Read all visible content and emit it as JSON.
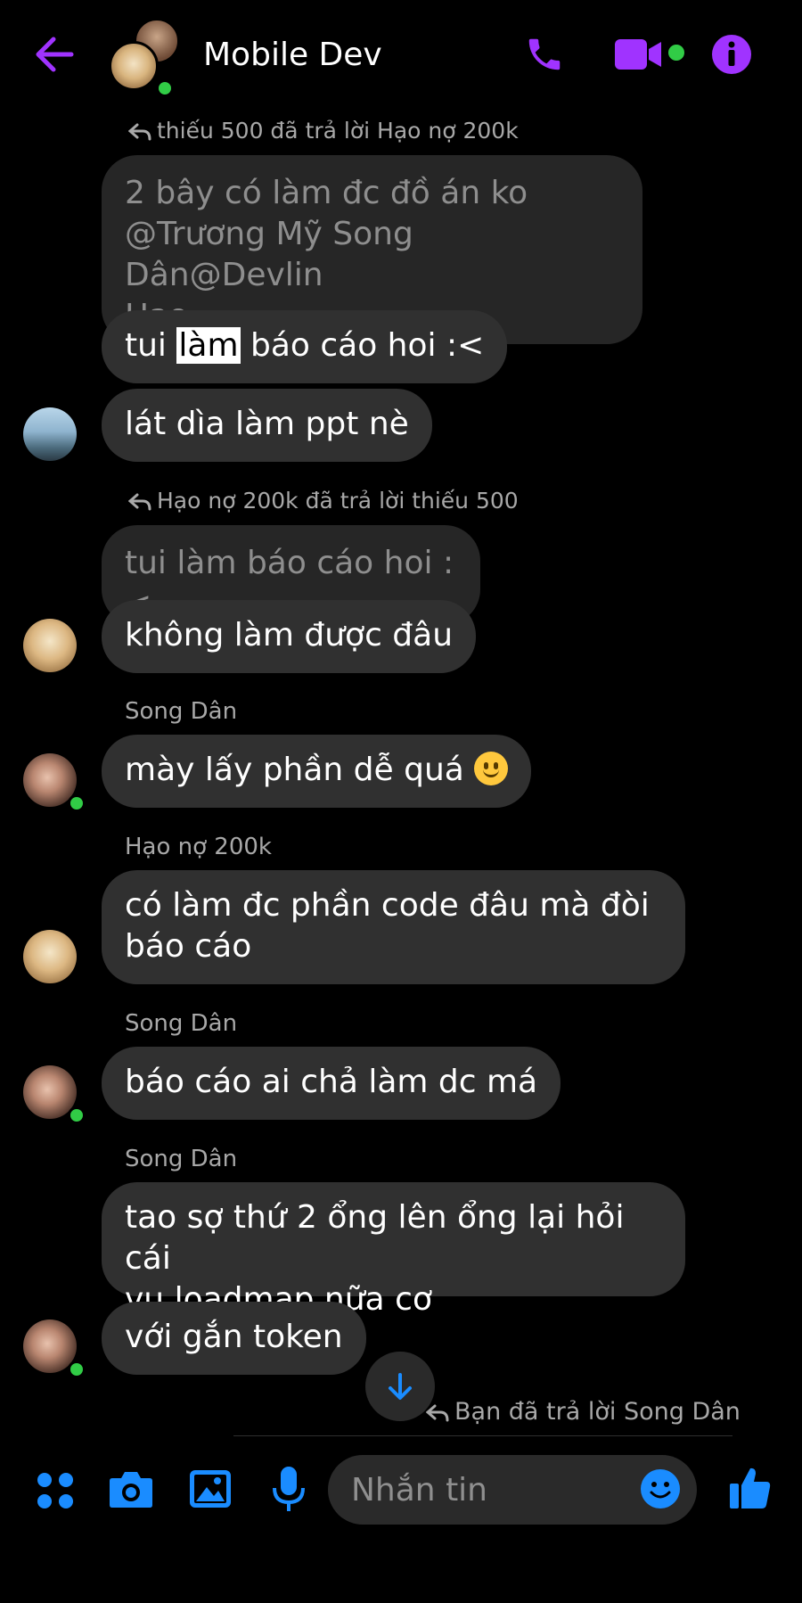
{
  "header": {
    "title": "Mobile Dev",
    "accent_color": "#a033ff",
    "icons": [
      "back-arrow-icon",
      "phone-icon",
      "video-camera-icon",
      "info-icon"
    ]
  },
  "messages": {
    "reply1": "thiếu 500 đã trả lời Hạo nợ 200k",
    "quoted1_line1": "2 bây có làm đc đồ án ko",
    "quoted1_line2": "@Trương Mỹ Song Dân@Devlin",
    "quoted1_line3": "Hạo",
    "msg1_pre": "tui ",
    "msg1_highlight": "làm",
    "msg1_post": " báo cáo hoi :<",
    "msg2": "lát dìa làm ppt nè",
    "reply2": "Hạo nợ 200k đã trả lời thiếu 500",
    "quoted2": "tui làm báo cáo hoi :<",
    "msg3": "không làm được đâu",
    "sender1": "Song Dân",
    "msg4": "mày lấy phần dễ quá",
    "sender2": "Hạo nợ 200k",
    "msg5_line1": "có làm đc phần code đâu mà đòi",
    "msg5_line2": "báo cáo",
    "sender3": "Song Dân",
    "msg6": "báo cáo ai chả làm dc má",
    "sender4": "Song Dân",
    "msg7_line1": "tao sợ thứ 2 ổng lên ổng lại hỏi cái",
    "msg7_line2": "vụ loadmap nữa cơ",
    "msg8": "với gắn token",
    "reply3": "Bạn đã trả lời Song Dân"
  },
  "composer": {
    "placeholder": "Nhắn tin",
    "icon_color": "#1a8cff",
    "icons": [
      "apps-icon",
      "camera-icon",
      "image-icon",
      "microphone-icon",
      "emoji-icon",
      "thumbs-up-icon"
    ]
  }
}
